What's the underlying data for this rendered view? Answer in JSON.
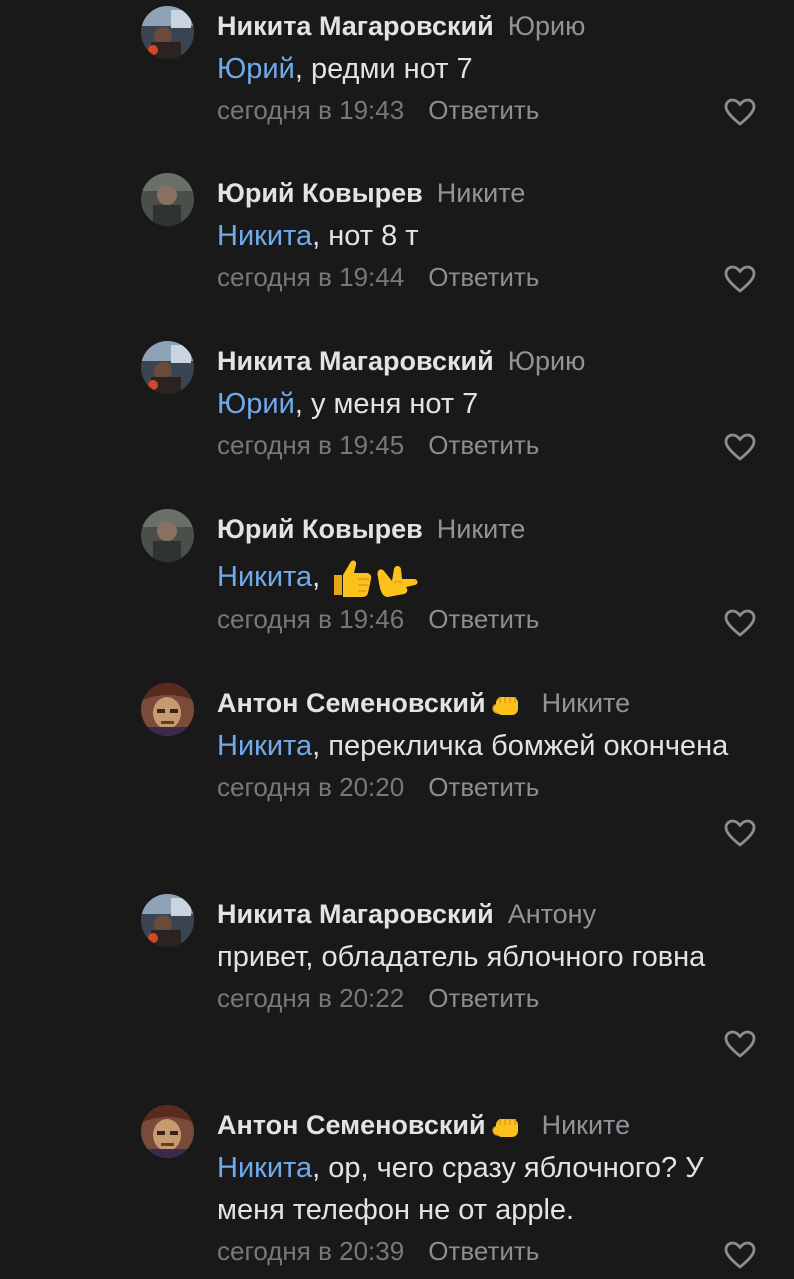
{
  "comments": [
    {
      "author": "Никита Магаровский",
      "reply_to": "Юрию",
      "mention": "Юрий",
      "text": ", редми нот 7",
      "time": "сегодня в 19:43",
      "reply_label": "Ответить",
      "avatar": "nikita",
      "badge": ""
    },
    {
      "author": "Юрий Ковырев",
      "reply_to": "Никите",
      "mention": "Никита",
      "text": ", нот 8 т",
      "time": "сегодня в 19:44",
      "reply_label": "Ответить",
      "avatar": "yuri",
      "badge": ""
    },
    {
      "author": "Никита Магаровский",
      "reply_to": "Юрию",
      "mention": "Юрий",
      "text": ", у меня нот 7",
      "time": "сегодня в 19:45",
      "reply_label": "Ответить",
      "avatar": "nikita",
      "badge": ""
    },
    {
      "author": "Юрий Ковырев",
      "reply_to": "Никите",
      "mention": "Никита",
      "text": ", ",
      "time": "сегодня в 19:46",
      "reply_label": "Ответить",
      "avatar": "yuri",
      "badge": "",
      "emojis": [
        "thumbs-up-emoji",
        "call-me-hand-emoji"
      ]
    },
    {
      "author": "Антон Семеновский",
      "reply_to": "Никите",
      "mention": "Никита",
      "text": ", перекличка бомжей окончена",
      "time": "сегодня в 20:20",
      "reply_label": "Ответить",
      "avatar": "anton",
      "badge": "fist-emoji"
    },
    {
      "author": "Никита Магаровский",
      "reply_to": "Антону",
      "mention": "",
      "text": "привет, обладатель яблочного говна",
      "time": "сегодня в 20:22",
      "reply_label": "Ответить",
      "avatar": "nikita",
      "badge": ""
    },
    {
      "author": "Антон Семеновский",
      "reply_to": "Никите",
      "mention": "Никита",
      "text": ", ор, чего сразу яблочного? У меня телефон не от apple.",
      "time": "сегодня в 20:39",
      "reply_label": "Ответить",
      "avatar": "anton",
      "badge": "fist-emoji"
    }
  ],
  "colors": {
    "background": "#19191a",
    "text": "#e1e3e6",
    "secondary": "#929398",
    "meta": "#76787a",
    "mention": "#71aaeb",
    "emoji": "#f7c21a"
  },
  "icons": {
    "like": "heart-outline-icon"
  }
}
